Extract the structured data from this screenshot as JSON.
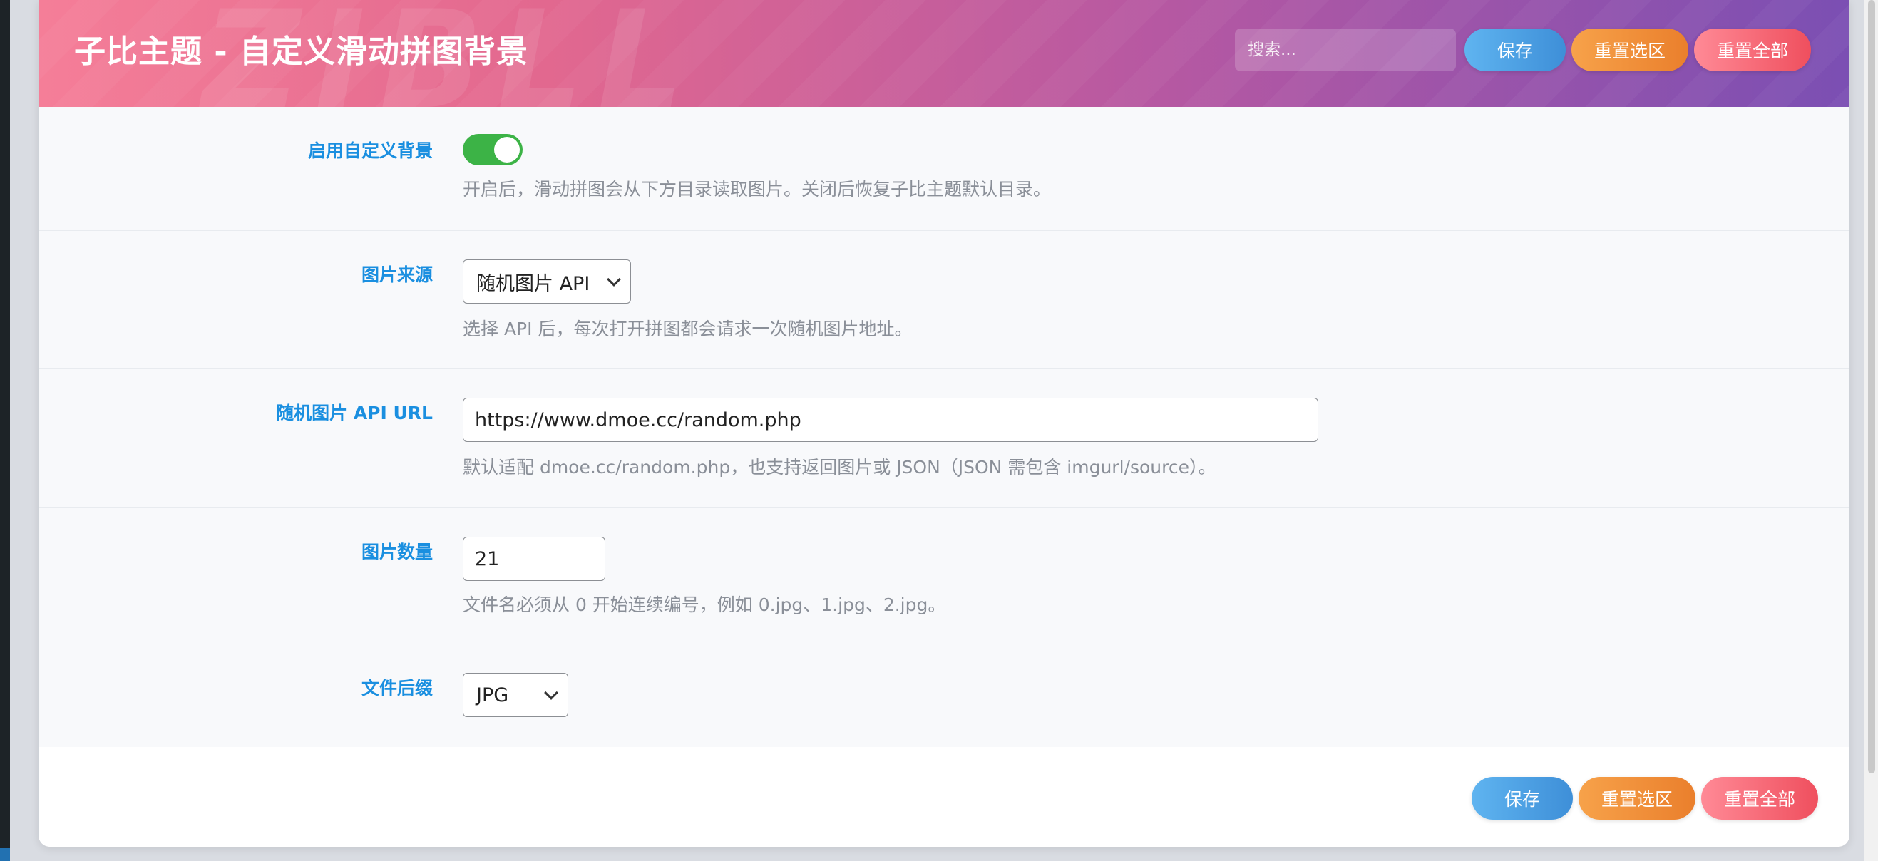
{
  "header": {
    "title": "子比主题 - 自定义滑动拼图背景",
    "watermark": "ZIBLL",
    "search_placeholder": "搜索...",
    "save_label": "保存",
    "reset_section_label": "重置选区",
    "reset_all_label": "重置全部"
  },
  "fields": {
    "enable": {
      "label": "启用自定义背景",
      "enabled": true,
      "desc": "开启后，滑动拼图会从下方目录读取图片。关闭后恢复子比主题默认目录。"
    },
    "source": {
      "label": "图片来源",
      "value": "随机图片 API",
      "desc": "选择 API 后，每次打开拼图都会请求一次随机图片地址。"
    },
    "api_url": {
      "label": "随机图片 API URL",
      "value": "https://www.dmoe.cc/random.php",
      "desc": "默认适配 dmoe.cc/random.php，也支持返回图片或 JSON（JSON 需包含 imgurl/source）。"
    },
    "count": {
      "label": "图片数量",
      "value": "21",
      "desc": "文件名必须从 0 开始连续编号，例如 0.jpg、1.jpg、2.jpg。"
    },
    "suffix": {
      "label": "文件后缀",
      "value": "JPG"
    }
  },
  "footer": {
    "save_label": "保存",
    "reset_section_label": "重置选区",
    "reset_all_label": "重置全部"
  },
  "colors": {
    "accent_label": "#1a8fe0",
    "toggle_on": "#3cb346",
    "save": "#3e8fd8",
    "reset_section": "#ea7f2c",
    "reset_all": "#ef4f5e"
  }
}
